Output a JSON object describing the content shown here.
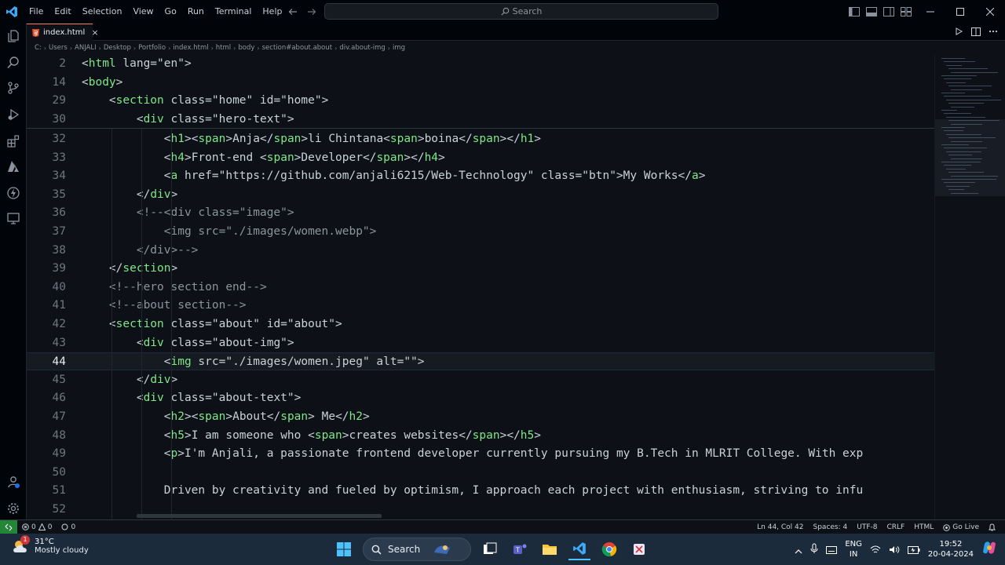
{
  "menu": [
    "File",
    "Edit",
    "Selection",
    "View",
    "Go",
    "Run",
    "Terminal",
    "Help"
  ],
  "search": {
    "label": "Search"
  },
  "tab": {
    "label": "index.html",
    "close": "×"
  },
  "breadcrumb": [
    "C:",
    "Users",
    "ANJALI",
    "Desktop",
    "Portfolio",
    "index.html",
    "html",
    "body",
    "section#about.about",
    "div.about-img",
    "img"
  ],
  "editor": {
    "sticky_lines": [
      {
        "n": "2",
        "code": "<html lang=\"en\">"
      },
      {
        "n": "14",
        "code": "<body>"
      },
      {
        "n": "29",
        "code": "    <section class=\"home\" id=\"home\">"
      },
      {
        "n": "30",
        "code": "        <div class=\"hero-text\">"
      }
    ],
    "lines": [
      {
        "n": "32",
        "code": "            <h1><span>Anja</span>li Chintana<span>boina</span></h1>"
      },
      {
        "n": "33",
        "code": "            <h4>Front-end <span>Developer</span></h4>"
      },
      {
        "n": "34",
        "code": "            <a href=\"https://github.com/anjali6215/Web-Technology\" class=\"btn\">My Works</a>"
      },
      {
        "n": "35",
        "code": "        </div>"
      },
      {
        "n": "36",
        "code": "        <!--<div class=\"image\">"
      },
      {
        "n": "37",
        "code": "            <img src=\"./images/women.webp\">"
      },
      {
        "n": "38",
        "code": "        </div>-->"
      },
      {
        "n": "39",
        "code": "    </section>"
      },
      {
        "n": "40",
        "code": "    <!--hero section end-->"
      },
      {
        "n": "41",
        "code": "    <!--about section-->"
      },
      {
        "n": "42",
        "code": "    <section class=\"about\" id=\"about\">"
      },
      {
        "n": "43",
        "code": "        <div class=\"about-img\">"
      },
      {
        "n": "44",
        "code": "            <img src=\"./images/women.jpeg\" alt=\"\">"
      },
      {
        "n": "45",
        "code": "        </div>"
      },
      {
        "n": "46",
        "code": "        <div class=\"about-text\">"
      },
      {
        "n": "47",
        "code": "            <h2><span>About</span> Me</h2>"
      },
      {
        "n": "48",
        "code": "            <h5>I am someone who <span>creates websites</span></h5>"
      },
      {
        "n": "49",
        "code": "            <p>I'm Anjali, a passionate frontend developer currently pursuing my B.Tech in MLRIT College. With exp"
      },
      {
        "n": "50",
        "code": ""
      },
      {
        "n": "51",
        "code": "            Driven by creativity and fueled by optimism, I approach each project with enthusiasm, striving to infu"
      },
      {
        "n": "52",
        "code": ""
      }
    ],
    "active_line": "44"
  },
  "status": {
    "errors": "0",
    "warnings": "0",
    "ports": "0",
    "position": "Ln 44, Col 42",
    "spaces": "Spaces: 4",
    "encoding": "UTF-8",
    "eol": "CRLF",
    "language": "HTML",
    "golive": "Go Live"
  },
  "taskbar": {
    "weather_badge": "1",
    "temperature": "31°C",
    "weather": "Mostly cloudy",
    "search": "Search",
    "lang_top": "ENG",
    "lang_bottom": "IN",
    "time": "19:52",
    "date": "20-04-2024"
  },
  "colors": {
    "accent": "#f78166",
    "tag": "#7ee787",
    "attr": "#79c0ff",
    "string": "#a5d6ff",
    "comment": "#8b949e",
    "remote": "#238636"
  }
}
